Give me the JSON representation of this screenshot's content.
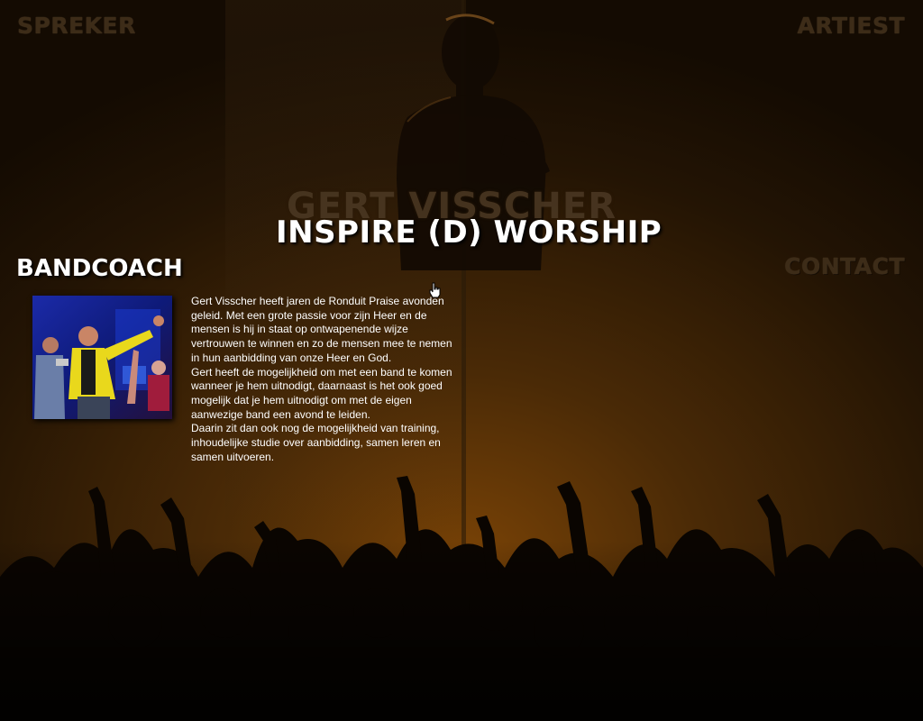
{
  "nav": {
    "spreker": "SPREKER",
    "artiest": "ARTIEST",
    "contact": "CONTACT"
  },
  "hero": {
    "name": "GERT VISSCHER",
    "title": "INSPIRE (D) WORSHIP"
  },
  "section": {
    "title": "BANDCOACH",
    "paragraphs": [
      "Gert Visscher heeft jaren de Ronduit Praise avonden geleid. Met een grote passie voor zijn Heer en de mensen is hij in staat op ontwapenende wijze vertrouwen te winnen en zo de mensen mee te nemen in hun aanbidding van onze Heer en God.",
      "Gert heeft de mogelijkheid om met een band te komen wanneer je hem uitnodigt, daarnaast is het ook goed mogelijk dat je hem uitnodigt om met de eigen aanwezige band een avond te leiden.",
      "Daarin zit dan ook nog de mogelijkheid van training, inhoudelijke studie over aanbidding, samen leren en samen uitvoeren."
    ]
  },
  "colors": {
    "background": "#1c1104",
    "glow": "#6b3c05",
    "nav_text": "#3d2c18",
    "heading": "#ffffff"
  }
}
